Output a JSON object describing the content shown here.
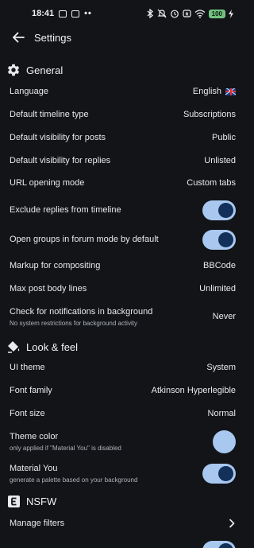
{
  "status_bar": {
    "time": "18:41",
    "dots": "••",
    "battery": "100"
  },
  "app_bar": {
    "title": "Settings",
    "back_icon": "arrow-left-icon"
  },
  "sections": {
    "general": {
      "title": "General",
      "icon": "gear-icon",
      "language": {
        "label": "Language",
        "value": "English",
        "flag_icon": "uk-flag-icon"
      },
      "default_timeline_type": {
        "label": "Default timeline type",
        "value": "Subscriptions"
      },
      "default_visibility_posts": {
        "label": "Default visibility for posts",
        "value": "Public"
      },
      "default_visibility_replies": {
        "label": "Default visibility for replies",
        "value": "Unlisted"
      },
      "url_opening_mode": {
        "label": "URL opening mode",
        "value": "Custom tabs"
      },
      "exclude_replies": {
        "label": "Exclude replies from timeline",
        "checked": true
      },
      "forum_mode": {
        "label": "Open groups in forum mode by default",
        "checked": true
      },
      "markup": {
        "label": "Markup for compositing",
        "value": "BBCode"
      },
      "max_lines": {
        "label": "Max post body lines",
        "value": "Unlimited"
      },
      "notifications_check": {
        "label": "Check for notifications in background",
        "subtitle": "No system restrictions for background activity",
        "value": "Never"
      }
    },
    "look_and_feel": {
      "title": "Look & feel",
      "icon": "paint-bucket-icon",
      "ui_theme": {
        "label": "UI theme",
        "value": "System"
      },
      "font_family": {
        "label": "Font family",
        "value": "Atkinson Hyperlegible"
      },
      "font_size": {
        "label": "Font size",
        "value": "Normal"
      },
      "theme_color": {
        "label": "Theme color",
        "subtitle": "only applied if \"Material You\" is disabled",
        "color": "#a8c8f0"
      },
      "material_you": {
        "label": "Material You",
        "subtitle": "generate a palette based on your background",
        "checked": true
      }
    },
    "nsfw": {
      "title": "NSFW",
      "icon": "explicit-icon",
      "manage_filters": {
        "label": "Manage filters",
        "chevron_icon": "chevron-right-icon"
      }
    }
  },
  "colors": {
    "background": "#121418",
    "toggle_track": "#a8c8f0",
    "toggle_knob": "#12305a",
    "battery": "#6dc17c"
  }
}
